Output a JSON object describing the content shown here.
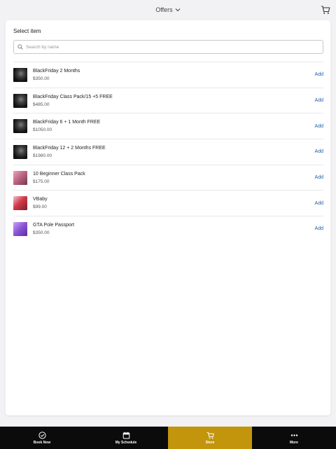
{
  "header": {
    "title": "Offers"
  },
  "card": {
    "title": "Select item",
    "search_placeholder": "Search by name"
  },
  "items": [
    {
      "name": "BlackFriday 2 Months",
      "price": "$350.00",
      "action": "Add",
      "thumb": "dark"
    },
    {
      "name": "BlackFriday Class Pack/15 +5 FREE",
      "price": "$485.00",
      "action": "Add",
      "thumb": "dark"
    },
    {
      "name": "BlackFriday 6 + 1 Month FREE",
      "price": "$1050.00",
      "action": "Add",
      "thumb": "dark"
    },
    {
      "name": "BlackFriday 12 + 2 Months FREE",
      "price": "$1980.00",
      "action": "Add",
      "thumb": "dark"
    },
    {
      "name": "10 Beginner Class Pack",
      "price": "$175.00",
      "action": "Add",
      "thumb": "pink"
    },
    {
      "name": "VBaby",
      "price": "$99.00",
      "action": "Add",
      "thumb": "red"
    },
    {
      "name": "GTA Pole Passport",
      "price": "$350.00",
      "action": "Add",
      "thumb": "purple"
    }
  ],
  "nav": [
    {
      "label": "Book Now",
      "icon": "check-circle-icon",
      "active": false
    },
    {
      "label": "My Schedule",
      "icon": "calendar-icon",
      "active": false
    },
    {
      "label": "Store",
      "icon": "cart-icon",
      "active": true
    },
    {
      "label": "More",
      "icon": "more-dots-icon",
      "active": false
    }
  ],
  "colors": {
    "accent": "#c2950d",
    "link": "#1e5fa8",
    "nav_bg": "#0b0b0b"
  }
}
